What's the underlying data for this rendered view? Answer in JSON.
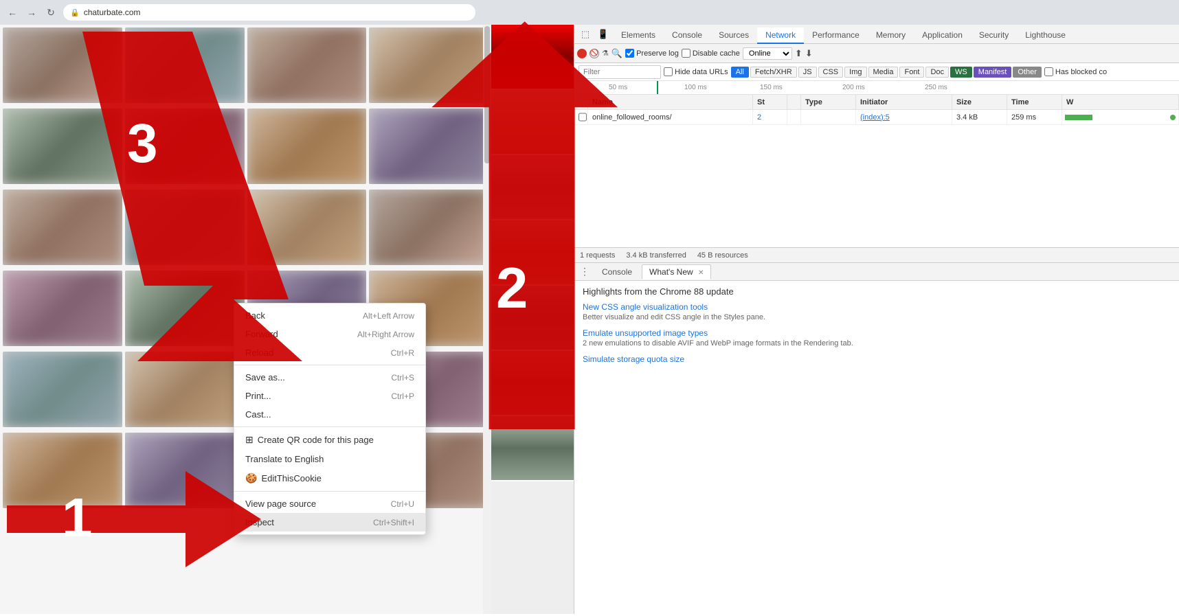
{
  "browser": {
    "url": "chaturbate.com",
    "back_label": "←",
    "forward_label": "→",
    "refresh_label": "↻"
  },
  "devtools": {
    "tabs": [
      {
        "label": "Elements",
        "active": false
      },
      {
        "label": "Console",
        "active": false
      },
      {
        "label": "Sources",
        "active": false
      },
      {
        "label": "Network",
        "active": true
      },
      {
        "label": "Performance",
        "active": false
      },
      {
        "label": "Memory",
        "active": false
      },
      {
        "label": "Application",
        "active": false
      },
      {
        "label": "Security",
        "active": false
      },
      {
        "label": "Lighthouse",
        "active": false
      }
    ],
    "network": {
      "preserve_log_label": "Preserve log",
      "disable_cache_label": "Disable cache",
      "online_label": "Online",
      "filter_placeholder": "Filter",
      "hide_data_urls_label": "Hide data URLs",
      "filter_tags": [
        "All",
        "Fetch/XHR",
        "JS",
        "CSS",
        "Img",
        "Media",
        "Font",
        "Doc",
        "WS",
        "Manifest",
        "Other"
      ],
      "has_blocked_label": "Has blocked co",
      "timeline_labels": [
        "50 ms",
        "100 ms",
        "150 ms",
        "200 ms",
        "250 ms"
      ],
      "table_headers": {
        "name": "Name",
        "status": "St",
        "type": "Type",
        "initiator": "Initiator",
        "size": "Size",
        "time": "Time",
        "waterfall": "W"
      },
      "rows": [
        {
          "name": "online_followed_rooms/",
          "status": "2",
          "type": "",
          "initiator": "(index):5",
          "size": "3.4 kB",
          "time": "259 ms"
        }
      ],
      "status_bar": {
        "requests": "1 requests",
        "transferred": "3.4 kB transferred",
        "resources": "45 B resources"
      }
    },
    "bottom_panel": {
      "tabs": [
        {
          "label": "Console",
          "active": false,
          "closable": false
        },
        {
          "label": "What's New",
          "active": true,
          "closable": true
        }
      ],
      "whats_new": {
        "title": "Highlights from the Chrome 88 update",
        "items": [
          {
            "link": "New CSS angle visualization tools",
            "desc": "Better visualize and edit CSS angle in the Styles pane."
          },
          {
            "link": "Emulate unsupported image types",
            "desc": "2 new emulations to disable AVIF and WebP image formats in the Rendering tab."
          },
          {
            "link": "Simulate storage quota size",
            "desc": ""
          }
        ]
      }
    }
  },
  "context_menu": {
    "items": [
      {
        "label": "Back",
        "shortcut": "Alt+Left Arrow",
        "icon": ""
      },
      {
        "label": "Forward",
        "shortcut": "Alt+Right Arrow",
        "icon": ""
      },
      {
        "label": "Reload",
        "shortcut": "Ctrl+R",
        "icon": ""
      },
      {
        "label": "divider1",
        "type": "divider"
      },
      {
        "label": "Save as...",
        "shortcut": "Ctrl+S",
        "icon": ""
      },
      {
        "label": "Print...",
        "shortcut": "Ctrl+P",
        "icon": ""
      },
      {
        "label": "Cast...",
        "shortcut": "",
        "icon": ""
      },
      {
        "label": "divider2",
        "type": "divider"
      },
      {
        "label": "Create QR code for this page",
        "shortcut": "",
        "icon": "qr"
      },
      {
        "label": "Translate to English",
        "shortcut": "",
        "icon": ""
      },
      {
        "label": "EditThisCookie",
        "shortcut": "",
        "icon": "cookie"
      },
      {
        "label": "divider3",
        "type": "divider"
      },
      {
        "label": "View page source",
        "shortcut": "Ctrl+U",
        "icon": ""
      },
      {
        "label": "Inspect",
        "shortcut": "Ctrl+Shift+I",
        "icon": "",
        "highlighted": true
      }
    ]
  },
  "arrows": {
    "arrow1_label": "1",
    "arrow2_label": "2",
    "arrow3_label": "3"
  }
}
